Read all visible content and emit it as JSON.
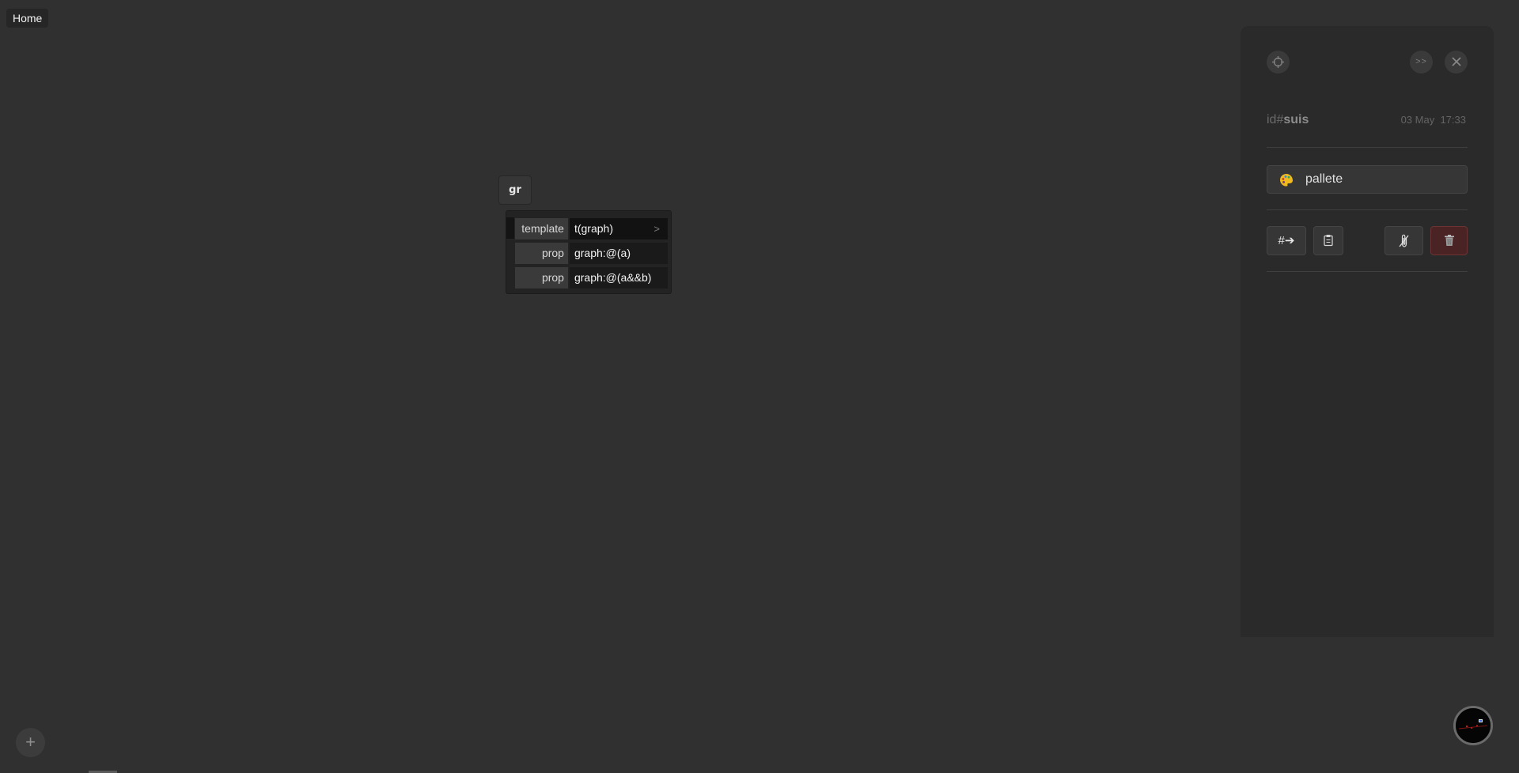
{
  "nav": {
    "home_tab": "Home"
  },
  "node": {
    "chip_label": "gr",
    "rows": [
      {
        "key": "template",
        "value": "t(graph)",
        "arrow": ">"
      },
      {
        "key": "prop",
        "value": "graph:@(a)"
      },
      {
        "key": "prop",
        "value": "graph:@(a&&b)"
      }
    ]
  },
  "panel": {
    "buttons": {
      "focus_icon": "target-icon",
      "expand_label": ">>",
      "close_icon": "close-icon"
    },
    "id_prefix": "id#",
    "id_value": "suis",
    "date": "03 May",
    "time": "17:33",
    "pallete": {
      "label": "pallete",
      "icon": "palette-icon"
    },
    "actions": {
      "hash_link_label": "#➔",
      "copy_icon": "clipboard-icon",
      "detach_icon": "paperclip-slash-icon",
      "delete_icon": "trash-icon"
    }
  },
  "bottom": {
    "add_label": "+",
    "avatar_icon": "avatar-image"
  },
  "colors": {
    "background": "#303030",
    "panel": "#2a2a2a",
    "delete_button": "#4a2425",
    "delete_border": "#6b3334",
    "pallete_icon": "#f0b91e"
  }
}
